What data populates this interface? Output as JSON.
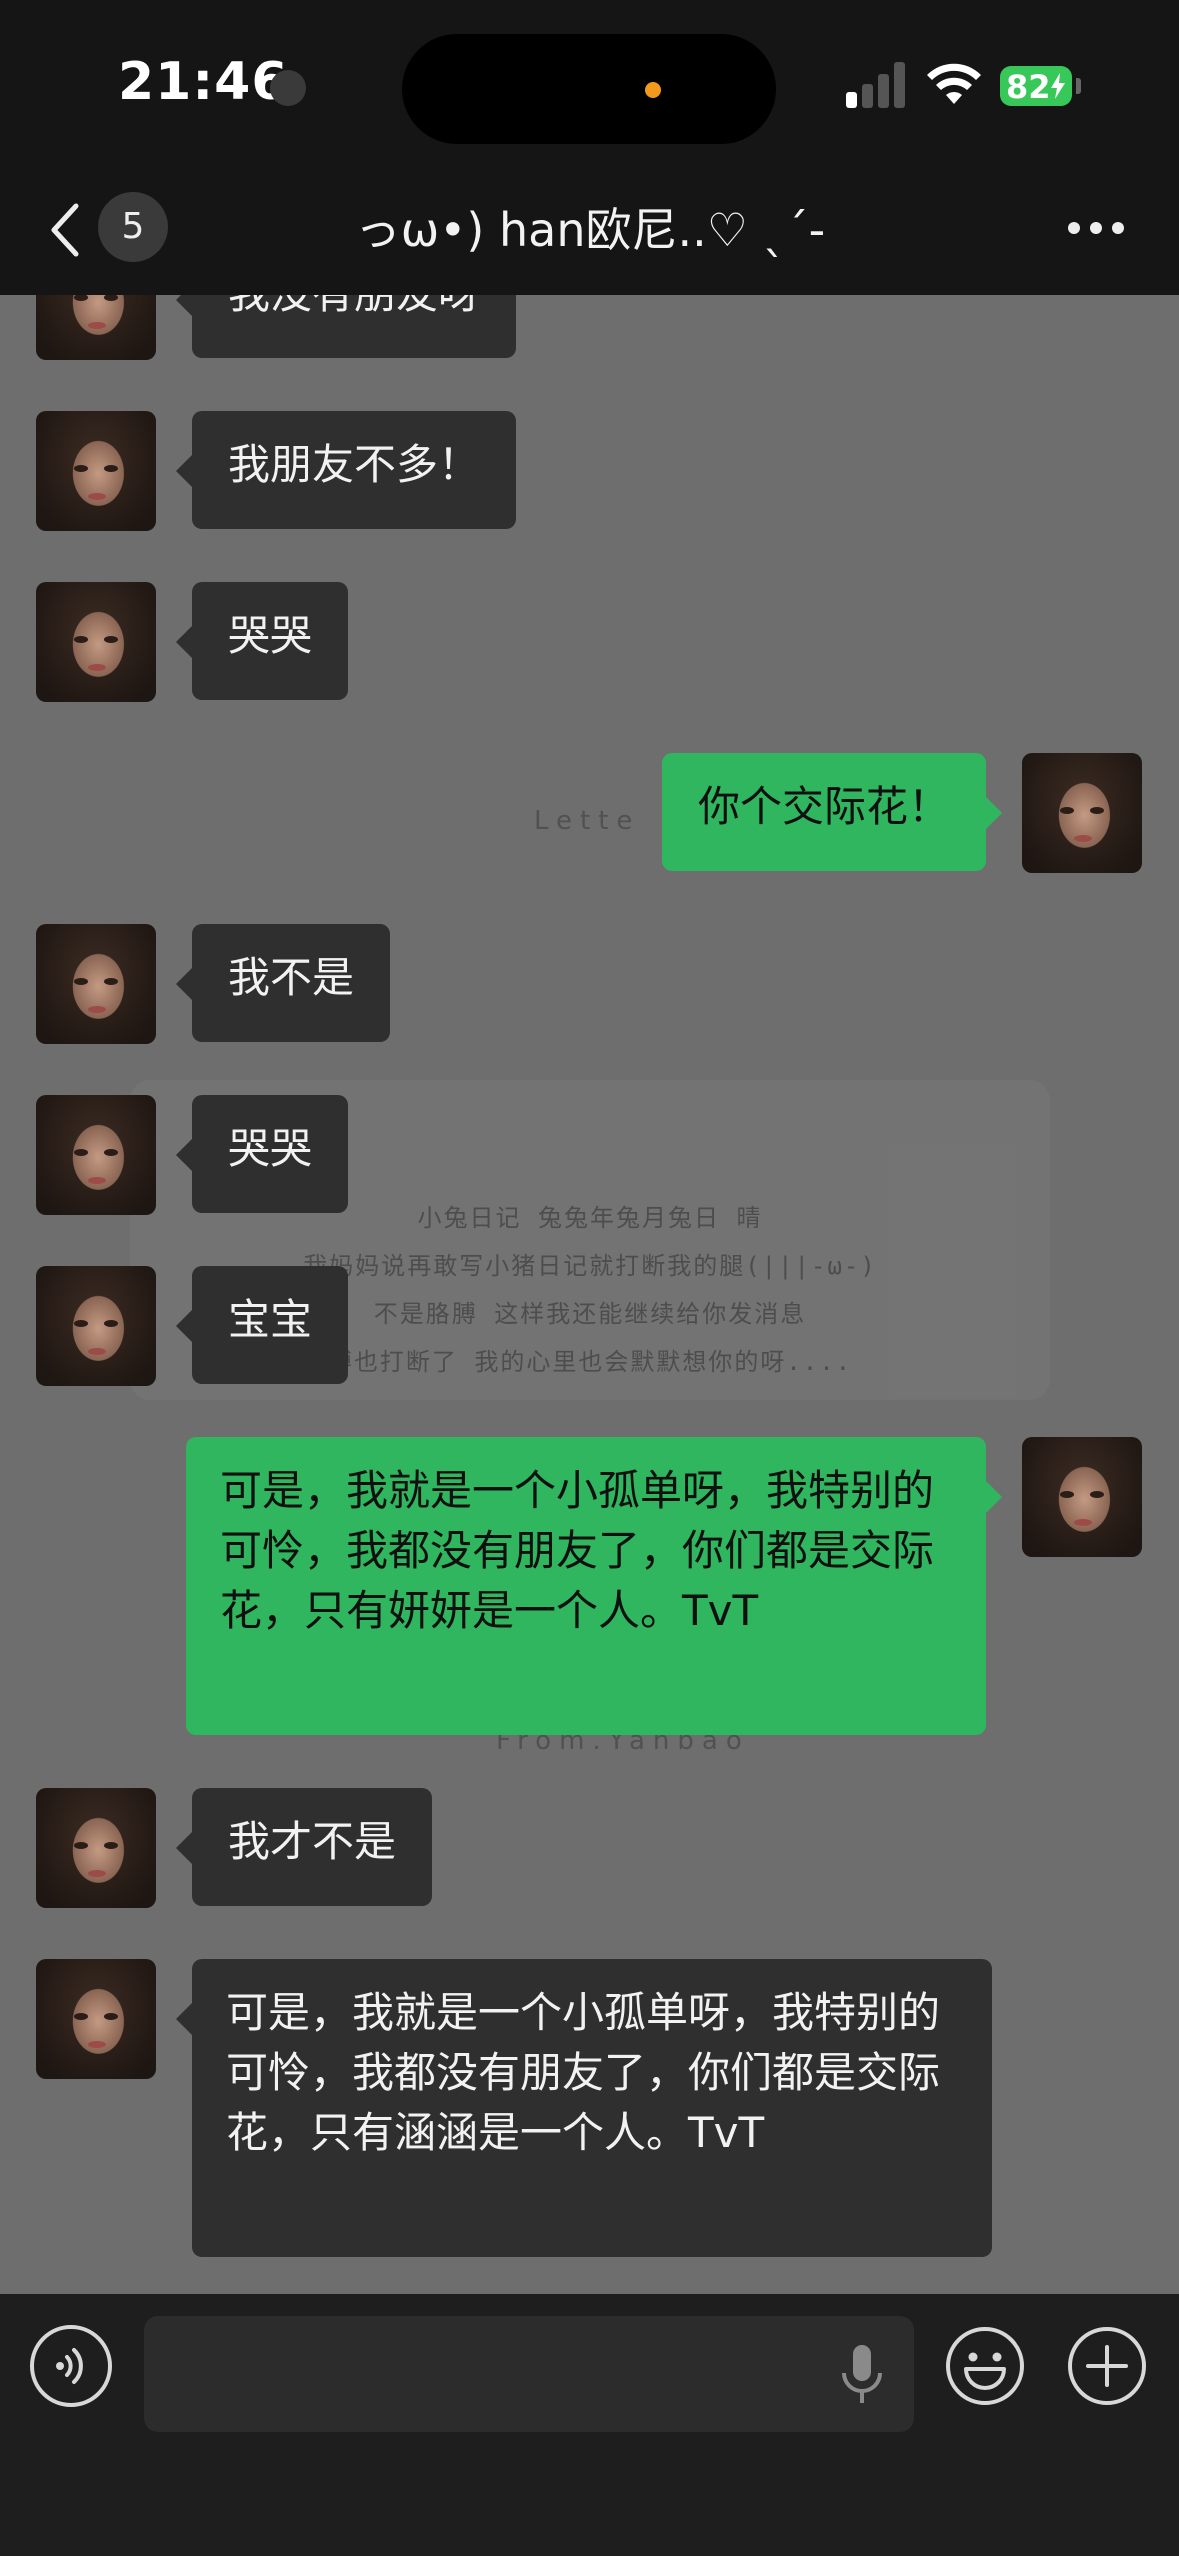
{
  "status_bar": {
    "time": "21:46",
    "battery": "82",
    "signal_bars_on": 1,
    "signal_bars_total": 4
  },
  "nav": {
    "unread_count": "5",
    "title": "っω•) han欧尼..♡ ˎ´-"
  },
  "background": {
    "letter_word": "Lette",
    "letter_lines": [
      "小兔日记 兔兔年兔月兔日 晴",
      "我妈妈说再敢写小猪日记就打断我的腿(|||-ω-)",
      "不是胳膊 这样我还能继续给你发消息",
      "膊也打断了 我的心里也会默默想你的呀...."
    ],
    "signature": "From.Yanbao"
  },
  "messages": [
    {
      "side": "in",
      "text": "我没有朋友呀"
    },
    {
      "side": "in",
      "text": "我朋友不多！"
    },
    {
      "side": "in",
      "text": "哭哭"
    },
    {
      "side": "out",
      "text": "你个交际花！"
    },
    {
      "side": "in",
      "text": "我不是"
    },
    {
      "side": "in",
      "text": "哭哭"
    },
    {
      "side": "in",
      "text": "宝宝"
    },
    {
      "side": "out",
      "text": " 可是，我就是一个小孤单呀，我特别的可怜，我都没有朋友了，你们都是交际花，只有妍妍是一个人。TvT"
    },
    {
      "side": "in",
      "text": "我才不是"
    },
    {
      "side": "in",
      "text": " 可是，我就是一个小孤单呀，我特别的可怜，我都没有朋友了，你们都是交际花，只有涵涵是一个人。TvT"
    }
  ],
  "input_bar": {
    "placeholder": ""
  },
  "colors": {
    "outgoing_bubble": "#2fb65e",
    "incoming_bubble": "#2f2f2f",
    "bar_background": "#151515",
    "battery": "#38c759"
  }
}
